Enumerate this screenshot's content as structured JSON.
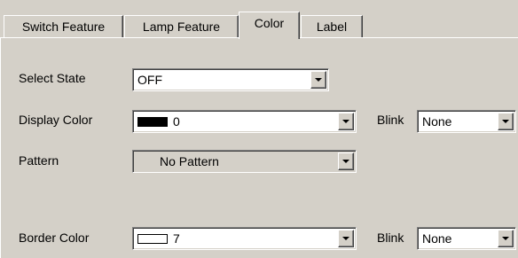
{
  "tabs": [
    {
      "label": "Switch Feature"
    },
    {
      "label": "Lamp Feature"
    },
    {
      "label": "Color"
    },
    {
      "label": "Label"
    }
  ],
  "active_tab": "Color",
  "select_state": {
    "label": "Select State",
    "value": "OFF"
  },
  "display_color": {
    "label": "Display Color",
    "value": "0",
    "swatch_color": "#000000"
  },
  "display_blink": {
    "label": "Blink",
    "value": "None"
  },
  "pattern": {
    "label": "Pattern",
    "value": "No Pattern"
  },
  "border_color": {
    "label": "Border Color",
    "value": "7",
    "swatch_color": "#ffffff"
  },
  "border_blink": {
    "label": "Blink",
    "value": "None"
  },
  "colors": {
    "face": "#d4d0c8",
    "field": "#ffffff"
  }
}
